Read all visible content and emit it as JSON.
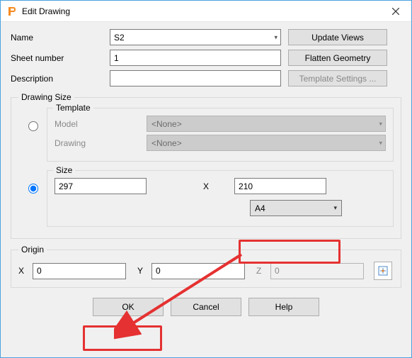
{
  "window": {
    "title": "Edit Drawing"
  },
  "fields": {
    "name_label": "Name",
    "name_value": "S2",
    "sheet_label": "Sheet number",
    "sheet_value": "1",
    "desc_label": "Description",
    "desc_value": ""
  },
  "buttons": {
    "update_views": "Update Views",
    "flatten": "Flatten Geometry",
    "template_settings": "Template Settings ...",
    "ok": "OK",
    "cancel": "Cancel",
    "help": "Help"
  },
  "drawing_size": {
    "legend": "Drawing Size",
    "template": {
      "legend": "Template",
      "model_label": "Model",
      "model_value": "<None>",
      "drawing_label": "Drawing",
      "drawing_value": "<None>"
    },
    "size": {
      "legend": "Size",
      "width": "297",
      "x_label": "X",
      "height": "210",
      "paper": "A4"
    }
  },
  "origin": {
    "legend": "Origin",
    "x_label": "X",
    "x_value": "0",
    "y_label": "Y",
    "y_value": "0",
    "z_label": "Z",
    "z_value": "0"
  }
}
